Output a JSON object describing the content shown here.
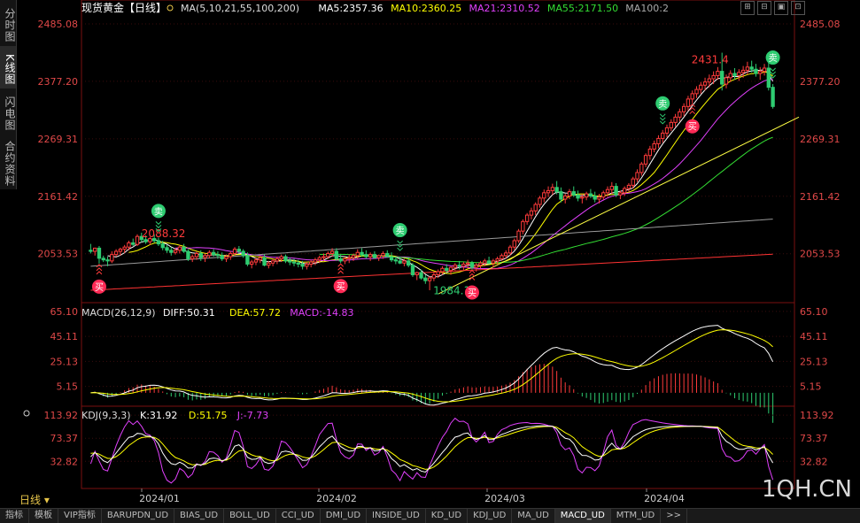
{
  "side_tabs": [
    {
      "label": "分时图"
    },
    {
      "label": "K线图"
    },
    {
      "label": "闪电图"
    },
    {
      "label": "合约资料"
    }
  ],
  "period_label": "日线",
  "watermark": "1QH.CN",
  "bottom_tabs": [
    "指标",
    "模板",
    "VIP指标",
    "BARUPDN_UD",
    "BIAS_UD",
    "BOLL_UD",
    "CCI_UD",
    "DMI_UD",
    "INSIDE_UD",
    "KD_UD",
    "KDJ_UD",
    "MA_UD",
    "MACD_UD",
    "MTM_UD",
    ">>"
  ],
  "active_bottom_tab": "MACD_UD",
  "chart_data": {
    "type": "candlestick",
    "main": {
      "title": "现货黄金【日线】",
      "legend": [
        {
          "text": "MA(5,10,21,55,100,200)",
          "color": "#dddddd"
        },
        {
          "text": "MA5:2357.36",
          "color": "#ffffff"
        },
        {
          "text": "MA10:2360.25",
          "color": "#ffff00"
        },
        {
          "text": "MA21:2310.52",
          "color": "#e040fb"
        },
        {
          "text": "MA55:2171.50",
          "color": "#33dd33"
        },
        {
          "text": "MA100:2",
          "color": "#aaaaaa"
        }
      ],
      "ylim": [
        1965,
        2500
      ],
      "yticks": [
        "2485.08",
        "2377.20",
        "2269.31",
        "2161.42",
        "2053.53"
      ],
      "annotations": [
        {
          "text": "2431.4",
          "value": 2431.4,
          "color": "#ff3b3b"
        },
        {
          "text": "2088.32",
          "value": 2088.32,
          "color": "#ff3b3b"
        },
        {
          "text": "1984.12",
          "value": 1984.12,
          "color": "#2ecc71"
        }
      ],
      "signals": [
        {
          "type": "buy",
          "label": "买",
          "index": 2
        },
        {
          "type": "sell",
          "label": "卖",
          "index": 16
        },
        {
          "type": "buy",
          "label": "买",
          "index": 59
        },
        {
          "type": "sell",
          "label": "卖",
          "index": 73
        },
        {
          "type": "buy",
          "label": "买",
          "index": 90
        },
        {
          "type": "sell",
          "label": "卖",
          "index": 135
        },
        {
          "type": "buy",
          "label": "买",
          "index": 142
        },
        {
          "type": "sell",
          "label": "卖",
          "index": 173
        }
      ],
      "candles": [
        [
          2060,
          2072,
          2054,
          2058
        ],
        [
          2058,
          2065,
          2050,
          2064
        ],
        [
          2064,
          2068,
          2035,
          2045
        ],
        [
          2045,
          2050,
          2038,
          2042
        ],
        [
          2042,
          2048,
          2030,
          2040
        ],
        [
          2040,
          2058,
          2036,
          2052
        ],
        [
          2052,
          2062,
          2048,
          2058
        ],
        [
          2058,
          2065,
          2050,
          2062
        ],
        [
          2062,
          2070,
          2055,
          2066
        ],
        [
          2066,
          2078,
          2060,
          2074
        ],
        [
          2074,
          2082,
          2068,
          2071
        ],
        [
          2071,
          2090,
          2068,
          2086
        ],
        [
          2086,
          2093,
          2075,
          2080
        ],
        [
          2080,
          2088,
          2072,
          2076
        ],
        [
          2076,
          2085,
          2070,
          2082
        ],
        [
          2082,
          2090,
          2074,
          2078
        ],
        [
          2078,
          2084,
          2068,
          2072
        ],
        [
          2072,
          2078,
          2060,
          2065
        ],
        [
          2065,
          2070,
          2055,
          2060
        ],
        [
          2060,
          2066,
          2050,
          2056
        ],
        [
          2056,
          2064,
          2052,
          2060
        ],
        [
          2060,
          2070,
          2054,
          2066
        ],
        [
          2066,
          2072,
          2055,
          2058
        ],
        [
          2058,
          2062,
          2040,
          2044
        ],
        [
          2044,
          2052,
          2038,
          2048
        ],
        [
          2048,
          2058,
          2042,
          2054
        ],
        [
          2054,
          2060,
          2040,
          2046
        ],
        [
          2046,
          2054,
          2038,
          2050
        ],
        [
          2050,
          2060,
          2045,
          2056
        ],
        [
          2056,
          2062,
          2048,
          2052
        ],
        [
          2052,
          2058,
          2044,
          2050
        ],
        [
          2050,
          2056,
          2040,
          2044
        ],
        [
          2044,
          2052,
          2038,
          2048
        ],
        [
          2048,
          2058,
          2042,
          2054
        ],
        [
          2054,
          2066,
          2050,
          2062
        ],
        [
          2062,
          2068,
          2054,
          2058
        ],
        [
          2058,
          2062,
          2046,
          2050
        ],
        [
          2050,
          2056,
          2030,
          2034
        ],
        [
          2034,
          2042,
          2026,
          2038
        ],
        [
          2038,
          2046,
          2032,
          2042
        ],
        [
          2042,
          2050,
          2036,
          2046
        ],
        [
          2046,
          2052,
          2030,
          2032
        ],
        [
          2032,
          2040,
          2026,
          2036
        ],
        [
          2036,
          2044,
          2030,
          2040
        ],
        [
          2040,
          2048,
          2034,
          2044
        ],
        [
          2044,
          2052,
          2038,
          2048
        ],
        [
          2048,
          2052,
          2036,
          2040
        ],
        [
          2040,
          2046,
          2032,
          2038
        ],
        [
          2038,
          2044,
          2030,
          2036
        ],
        [
          2036,
          2042,
          2028,
          2034
        ],
        [
          2034,
          2040,
          2024,
          2030
        ],
        [
          2030,
          2038,
          2024,
          2034
        ],
        [
          2034,
          2042,
          2028,
          2038
        ],
        [
          2038,
          2046,
          2032,
          2042
        ],
        [
          2042,
          2050,
          2036,
          2046
        ],
        [
          2046,
          2054,
          2040,
          2048
        ],
        [
          2048,
          2058,
          2044,
          2054
        ],
        [
          2054,
          2064,
          2048,
          2058
        ],
        [
          2058,
          2064,
          2040,
          2044
        ],
        [
          2044,
          2052,
          2036,
          2040
        ],
        [
          2040,
          2048,
          2034,
          2044
        ],
        [
          2044,
          2052,
          2036,
          2046
        ],
        [
          2046,
          2054,
          2040,
          2050
        ],
        [
          2050,
          2062,
          2044,
          2056
        ],
        [
          2056,
          2064,
          2048,
          2052
        ],
        [
          2052,
          2060,
          2044,
          2048
        ],
        [
          2048,
          2056,
          2040,
          2052
        ],
        [
          2052,
          2058,
          2044,
          2046
        ],
        [
          2046,
          2052,
          2040,
          2050
        ],
        [
          2050,
          2058,
          2044,
          2054
        ],
        [
          2054,
          2060,
          2046,
          2048
        ],
        [
          2048,
          2056,
          2038,
          2042
        ],
        [
          2042,
          2048,
          2034,
          2040
        ],
        [
          2040,
          2048,
          2034,
          2036
        ],
        [
          2036,
          2044,
          2030,
          2040
        ],
        [
          2040,
          2046,
          2028,
          2032
        ],
        [
          2032,
          2036,
          2010,
          2014
        ],
        [
          2014,
          2020,
          2004,
          2018
        ],
        [
          2018,
          2024,
          2005,
          2008
        ],
        [
          2008,
          2014,
          1997,
          2003
        ],
        [
          2003,
          2012,
          1985,
          2008
        ],
        [
          2008,
          2018,
          2002,
          2014
        ],
        [
          2014,
          2024,
          2008,
          2020
        ],
        [
          2020,
          2030,
          2014,
          2026
        ],
        [
          2026,
          2034,
          2018,
          2022
        ],
        [
          2022,
          2030,
          2014,
          2028
        ],
        [
          2028,
          2036,
          2022,
          2032
        ],
        [
          2032,
          2040,
          2024,
          2030
        ],
        [
          2030,
          2038,
          2022,
          2034
        ],
        [
          2034,
          2042,
          2026,
          2036
        ],
        [
          2036,
          2040,
          2024,
          2028
        ],
        [
          2028,
          2036,
          2020,
          2032
        ],
        [
          2032,
          2040,
          2026,
          2036
        ],
        [
          2036,
          2044,
          2030,
          2040
        ],
        [
          2040,
          2048,
          2034,
          2036
        ],
        [
          2036,
          2044,
          2028,
          2040
        ],
        [
          2040,
          2048,
          2034,
          2044
        ],
        [
          2044,
          2054,
          2040,
          2050
        ],
        [
          2050,
          2060,
          2044,
          2055
        ],
        [
          2055,
          2070,
          2050,
          2066
        ],
        [
          2066,
          2082,
          2060,
          2078
        ],
        [
          2078,
          2100,
          2074,
          2096
        ],
        [
          2096,
          2118,
          2090,
          2114
        ],
        [
          2114,
          2130,
          2108,
          2126
        ],
        [
          2126,
          2140,
          2118,
          2134
        ],
        [
          2134,
          2150,
          2126,
          2146
        ],
        [
          2146,
          2162,
          2140,
          2158
        ],
        [
          2158,
          2174,
          2150,
          2168
        ],
        [
          2168,
          2180,
          2160,
          2172
        ],
        [
          2172,
          2185,
          2164,
          2178
        ],
        [
          2178,
          2190,
          2165,
          2170
        ],
        [
          2170,
          2178,
          2150,
          2156
        ],
        [
          2156,
          2166,
          2148,
          2162
        ],
        [
          2162,
          2175,
          2156,
          2170
        ],
        [
          2170,
          2180,
          2160,
          2164
        ],
        [
          2164,
          2172,
          2152,
          2158
        ],
        [
          2158,
          2166,
          2148,
          2160
        ],
        [
          2160,
          2170,
          2154,
          2166
        ],
        [
          2166,
          2175,
          2158,
          2162
        ],
        [
          2162,
          2170,
          2150,
          2156
        ],
        [
          2156,
          2166,
          2148,
          2160
        ],
        [
          2160,
          2172,
          2155,
          2168
        ],
        [
          2168,
          2180,
          2160,
          2174
        ],
        [
          2174,
          2188,
          2166,
          2180
        ],
        [
          2180,
          2186,
          2160,
          2164
        ],
        [
          2164,
          2172,
          2156,
          2168
        ],
        [
          2168,
          2180,
          2162,
          2176
        ],
        [
          2176,
          2186,
          2170,
          2182
        ],
        [
          2182,
          2198,
          2176,
          2194
        ],
        [
          2194,
          2212,
          2188,
          2206
        ],
        [
          2206,
          2226,
          2200,
          2222
        ],
        [
          2222,
          2242,
          2216,
          2238
        ],
        [
          2238,
          2256,
          2230,
          2250
        ],
        [
          2250,
          2266,
          2244,
          2260
        ],
        [
          2260,
          2276,
          2252,
          2270
        ],
        [
          2270,
          2286,
          2262,
          2280
        ],
        [
          2280,
          2296,
          2272,
          2290
        ],
        [
          2290,
          2306,
          2284,
          2300
        ],
        [
          2300,
          2316,
          2292,
          2310
        ],
        [
          2310,
          2326,
          2302,
          2320
        ],
        [
          2320,
          2336,
          2312,
          2330
        ],
        [
          2330,
          2350,
          2322,
          2344
        ],
        [
          2344,
          2360,
          2336,
          2354
        ],
        [
          2354,
          2368,
          2346,
          2362
        ],
        [
          2362,
          2376,
          2354,
          2370
        ],
        [
          2370,
          2384,
          2360,
          2376
        ],
        [
          2376,
          2390,
          2366,
          2382
        ],
        [
          2382,
          2396,
          2372,
          2388
        ],
        [
          2388,
          2404,
          2380,
          2396
        ],
        [
          2396,
          2431,
          2360,
          2372
        ],
        [
          2372,
          2390,
          2364,
          2384
        ],
        [
          2384,
          2398,
          2376,
          2392
        ],
        [
          2392,
          2402,
          2380,
          2388
        ],
        [
          2388,
          2400,
          2378,
          2394
        ],
        [
          2394,
          2406,
          2384,
          2398
        ],
        [
          2398,
          2414,
          2390,
          2404
        ],
        [
          2404,
          2416,
          2394,
          2400
        ],
        [
          2400,
          2410,
          2386,
          2392
        ],
        [
          2392,
          2404,
          2380,
          2396
        ],
        [
          2396,
          2410,
          2388,
          2402
        ],
        [
          2402,
          2412,
          2360,
          2366
        ],
        [
          2366,
          2372,
          2326,
          2330
        ]
      ],
      "dates": [
        "2024/01",
        "2024/02",
        "2024/03",
        "2024/04"
      ]
    },
    "macd": {
      "title": "MACD(26,12,9)",
      "legend": [
        {
          "text": "DIFF:50.31",
          "color": "#ffffff"
        },
        {
          "text": "DEA:57.72",
          "color": "#ffff00"
        },
        {
          "text": "MACD:-14.83",
          "color": "#e040fb"
        }
      ],
      "ylim": [
        -10,
        70
      ],
      "yticks": [
        "65.10",
        "45.11",
        "25.13",
        "5.15"
      ]
    },
    "kdj": {
      "title": "KDJ(9,3,3)",
      "legend": [
        {
          "text": "K:31.92",
          "color": "#ffffff"
        },
        {
          "text": "D:51.75",
          "color": "#ffff00"
        },
        {
          "text": "J:-7.73",
          "color": "#e040fb"
        }
      ],
      "ylim": [
        -15,
        125
      ],
      "yticks": [
        "113.92",
        "73.37",
        "32.82"
      ]
    }
  }
}
